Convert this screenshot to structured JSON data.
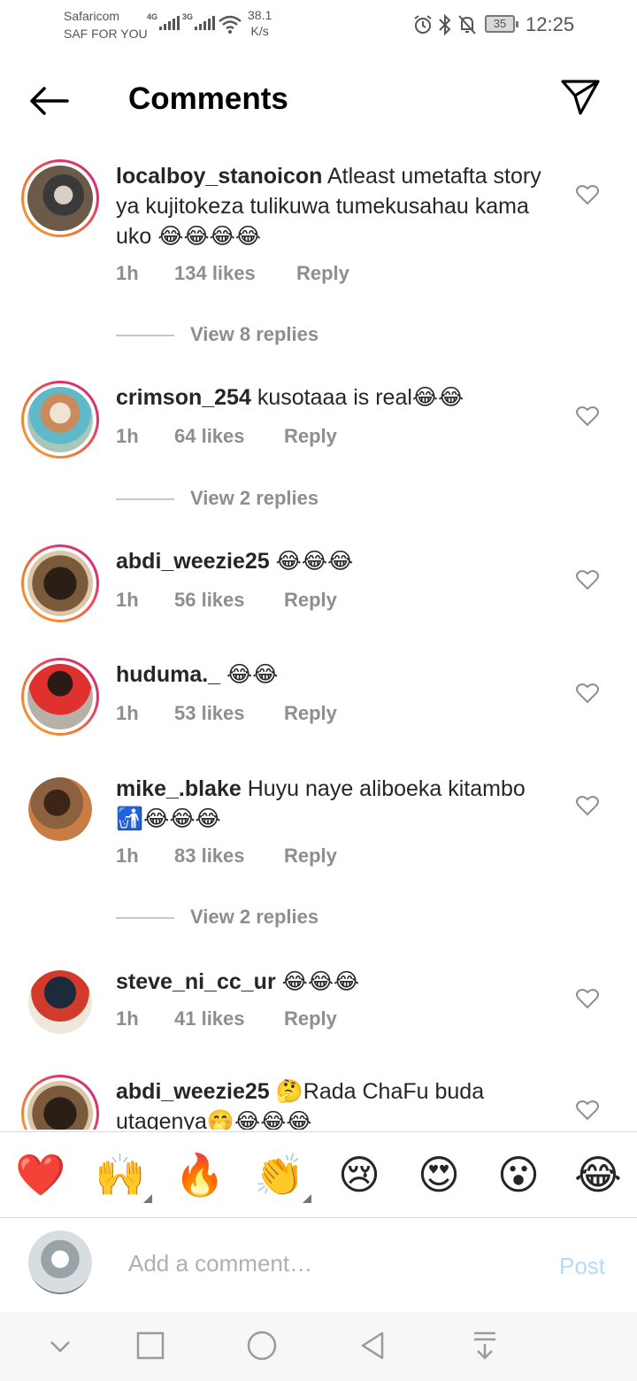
{
  "status_bar": {
    "carrier_name": "Safaricom",
    "carrier_sub": "SAF FOR YOU",
    "signal1_label": "4G",
    "signal2_label": "3G",
    "speed_value": "38.1",
    "speed_unit": "K/s",
    "battery": "35",
    "time": "12:25"
  },
  "header": {
    "title": "Comments"
  },
  "comments": [
    {
      "username": "localboy_stanoicon",
      "text": " Atleast umetafta story ya kujitokeza tulikuwa tumekusahau kama uko 😂😂😂😂",
      "time": "1h",
      "likes": "134 likes",
      "reply": "Reply",
      "view_replies": "View 8 replies"
    },
    {
      "username": "crimson_254",
      "text": " kusotaaa is real😂😂",
      "time": "1h",
      "likes": "64 likes",
      "reply": "Reply",
      "view_replies": "View 2 replies"
    },
    {
      "username": "abdi_weezie25",
      "text": " 😂😂😂",
      "time": "1h",
      "likes": "56 likes",
      "reply": "Reply"
    },
    {
      "username": "huduma._",
      "text": " 😂😂",
      "time": "1h",
      "likes": "53 likes",
      "reply": "Reply"
    },
    {
      "username": "mike_.blake",
      "text": " Huyu naye aliboeka kitambo🚮😂😂😂",
      "time": "1h",
      "likes": "83 likes",
      "reply": "Reply",
      "view_replies": "View 2 replies"
    },
    {
      "username": "steve_ni_cc_ur",
      "text": " 😂😂😂",
      "time": "1h",
      "likes": "41 likes",
      "reply": "Reply"
    },
    {
      "username": "abdi_weezie25",
      "text": " 🤔Rada ChaFu buda utagenya🤭😂😂😂"
    }
  ],
  "reactions": [
    "❤️",
    "🙌",
    "🔥",
    "👏",
    "😢",
    "😍",
    "😮",
    "😂"
  ],
  "compose": {
    "placeholder": "Add a comment…",
    "post_label": "Post"
  },
  "colors": {
    "ring_start": "#f9a52d",
    "ring_end": "#c13584",
    "muted_text": "#8e8e8e",
    "post_disabled": "#b3dbff"
  }
}
